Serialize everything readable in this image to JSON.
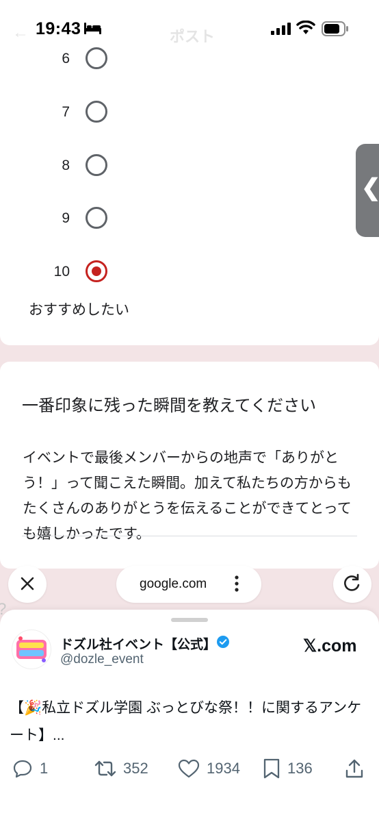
{
  "status_bar": {
    "time": "19:43",
    "ghost_title": "ポスト"
  },
  "form": {
    "scale_options": [
      {
        "label": "6",
        "selected": false
      },
      {
        "label": "7",
        "selected": false
      },
      {
        "label": "8",
        "selected": false
      },
      {
        "label": "9",
        "selected": false
      },
      {
        "label": "10",
        "selected": true
      }
    ],
    "scale_max_label": "おすすめしたい",
    "question_title": "一番印象に残った瞬間を教えてください",
    "answer": "イベントで最後メンバーからの地声で「ありがとう！」って聞こえた瞬間。加えて私たちの方からもたくさんのありがとうを伝えることができてとっても嬉しかったです。"
  },
  "browser": {
    "url": "google.com",
    "icons": [
      "close-icon",
      "more-vert-icon",
      "reload-icon"
    ]
  },
  "post": {
    "author_name": "ドズル社イベント【公式】",
    "author_handle": "@dozle_event",
    "source_site": "𝕏.com",
    "text": "【🎉私立ドズル学園 ぶっとびな祭！！に関するアンケート】...",
    "replies": "1",
    "reposts": "352",
    "likes": "1934",
    "bookmarks": "136"
  },
  "colors": {
    "accent_red": "#c5221f",
    "page_bg": "#f3e4e6",
    "text_secondary": "#536471"
  }
}
